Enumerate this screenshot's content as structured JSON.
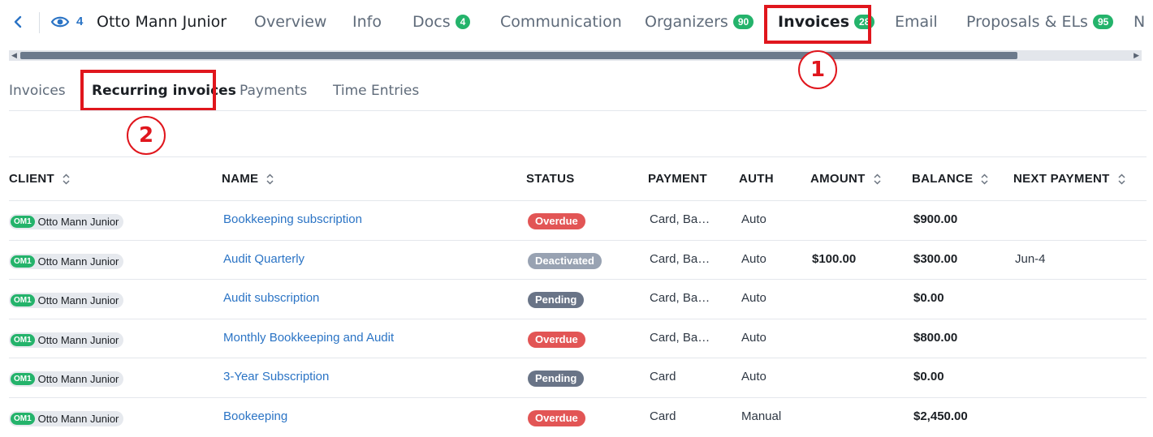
{
  "header": {
    "watch_count": "4",
    "client_name": "Otto Mann Junior",
    "tabs": [
      {
        "label": "Overview",
        "badge": null
      },
      {
        "label": "Info",
        "badge": null
      },
      {
        "label": "Docs",
        "badge": "4"
      },
      {
        "label": "Communication",
        "badge": null
      },
      {
        "label": "Organizers",
        "badge": "90"
      },
      {
        "label": "Invoices",
        "badge": "28",
        "active": true
      },
      {
        "label": "Email",
        "badge": null
      },
      {
        "label": "Proposals & ELs",
        "badge": "95"
      },
      {
        "label": "N",
        "badge": null
      }
    ]
  },
  "subtabs": [
    {
      "label": "Invoices"
    },
    {
      "label": "Recurring invoices",
      "active": true
    },
    {
      "label": "Payments"
    },
    {
      "label": "Time Entries"
    }
  ],
  "callouts": [
    "1",
    "2"
  ],
  "table": {
    "columns": [
      "CLIENT",
      "NAME",
      "STATUS",
      "PAYMENT",
      "AUTH",
      "AMOUNT",
      "BALANCE",
      "NEXT PAYMENT"
    ],
    "rows": [
      {
        "client_initials": "OM1",
        "client": "Otto Mann Junior",
        "name": "Bookkeeping subscription",
        "status": "Overdue",
        "payment": "Card, Ba…",
        "auth": "Auto",
        "amount": "",
        "balance": "$900.00",
        "next_payment": ""
      },
      {
        "client_initials": "OM1",
        "client": "Otto Mann Junior",
        "name": "Audit Quarterly",
        "status": "Deactivated",
        "payment": "Card, Ba…",
        "auth": "Auto",
        "amount": "$100.00",
        "balance": "$300.00",
        "next_payment": "Jun-4"
      },
      {
        "client_initials": "OM1",
        "client": "Otto Mann Junior",
        "name": "Audit subscription",
        "status": "Pending",
        "payment": "Card, Ba…",
        "auth": "Auto",
        "amount": "",
        "balance": "$0.00",
        "next_payment": ""
      },
      {
        "client_initials": "OM1",
        "client": "Otto Mann Junior",
        "name": "Monthly Bookkeeping and Audit",
        "status": "Overdue",
        "payment": "Card, Ba…",
        "auth": "Auto",
        "amount": "",
        "balance": "$800.00",
        "next_payment": ""
      },
      {
        "client_initials": "OM1",
        "client": "Otto Mann Junior",
        "name": "3-Year Subscription",
        "status": "Pending",
        "payment": "Card",
        "auth": "Auto",
        "amount": "",
        "balance": "$0.00",
        "next_payment": ""
      },
      {
        "client_initials": "OM1",
        "client": "Otto Mann Junior",
        "name": "Bookeeping",
        "status": "Overdue",
        "payment": "Card",
        "auth": "Manual",
        "amount": "",
        "balance": "$2,450.00",
        "next_payment": ""
      }
    ]
  },
  "icons": {
    "back": "chevron-left-icon",
    "watch": "eye-icon",
    "sort": "sort-icon"
  },
  "colors": {
    "accent": "#2b74c5",
    "badge": "#24b36b",
    "highlight": "#e0161d",
    "overdue": "#e25555",
    "deactivated": "#98a2b2",
    "pending": "#697487"
  }
}
